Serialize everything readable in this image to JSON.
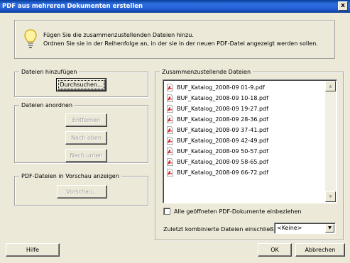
{
  "window": {
    "title": "PDF aus mehreren Dokumenten erstellen",
    "close_label": "x"
  },
  "info": {
    "line1": "Fügen Sie die zusammenzustellenden Dateien hinzu.",
    "line2": "Ordnen Sie sie in der Reihenfolge an, in der sie in der neuen PDF-Datei angezeigt werden sollen."
  },
  "add_group": {
    "legend": "Dateien hinzufügen",
    "browse_label": "Durchsuchen..."
  },
  "arrange_group": {
    "legend": "Dateien anordnen",
    "remove_label": "Entfernen",
    "up_label": "Nach oben",
    "down_label": "Nach unten"
  },
  "preview_group": {
    "legend": "PDF-Dateien in Vorschau anzeigen",
    "preview_label": "Vorschau..."
  },
  "files_group": {
    "legend": "Zusammenzustellende Dateien",
    "files": [
      "BUF_Katalog_2008-09 01-9.pdf",
      "BUF_Katalog_2008-09 10-18.pdf",
      "BUF_Katalog_2008-09 19-27.pdf",
      "BUF_Katalog_2008-09 28-36.pdf",
      "BUF_Katalog_2008-09 37-41.pdf",
      "BUF_Katalog_2008-09 42-49.pdf",
      "BUF_Katalog_2008-09 50-57.pdf",
      "BUF_Katalog_2008-09 58-65.pdf",
      "BUF_Katalog_2008-09 66-72.pdf"
    ]
  },
  "options": {
    "include_open_label": "Alle geöffneten PDF-Dokumente einbeziehen",
    "include_open_checked": false,
    "recent_label": "Zuletzt kombinierte Dateien einschließen:",
    "recent_value": "<Keine>"
  },
  "footer": {
    "help_label": "Hilfe",
    "ok_label": "OK",
    "cancel_label": "Abbrechen"
  },
  "colors": {
    "titlebar": "#245ed6",
    "dialog_bg": "#ece9d8",
    "pdf_red": "#d01818"
  }
}
